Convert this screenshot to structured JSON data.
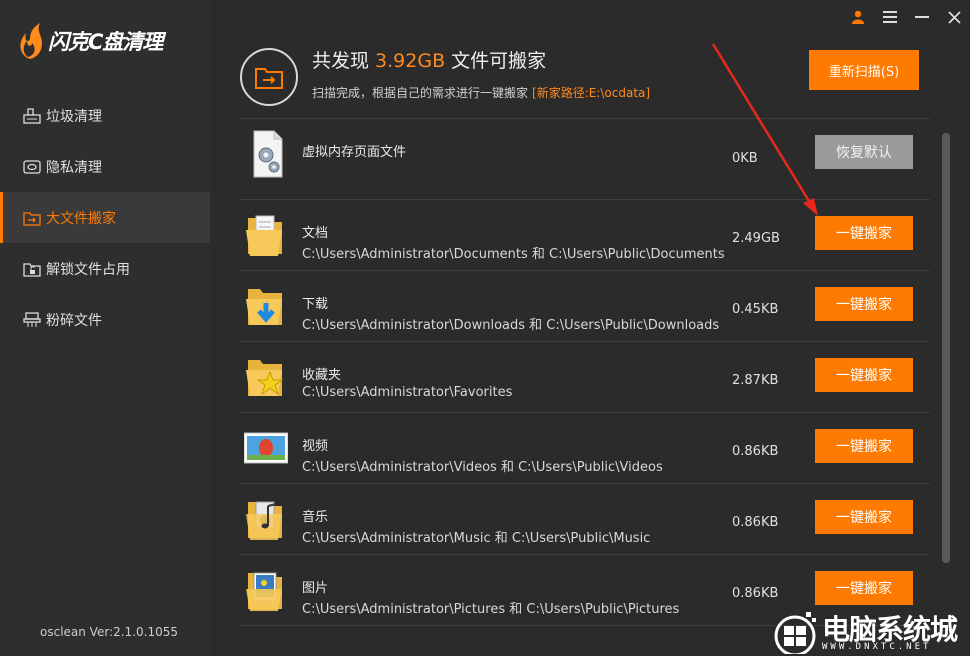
{
  "app": {
    "title": "闪克C盘清理",
    "version": "osclean Ver:2.1.0.1055"
  },
  "sidebar": {
    "items": [
      {
        "label": "垃圾清理",
        "icon": "broom-icon",
        "active": false
      },
      {
        "label": "隐私清理",
        "icon": "privacy-icon",
        "active": false
      },
      {
        "label": "大文件搬家",
        "icon": "move-file-icon",
        "active": true
      },
      {
        "label": "解锁文件占用",
        "icon": "unlock-file-icon",
        "active": false
      },
      {
        "label": "粉碎文件",
        "icon": "shredder-icon",
        "active": false
      }
    ]
  },
  "header": {
    "title_prefix": "共发现 ",
    "title_size": "3.92GB",
    "title_suffix": " 文件可搬家",
    "subtitle": "扫描完成，根据自己的需求进行一键搬家",
    "new_path": "[新家路径:E:\\ocdata]",
    "rescan_label": "重新扫描(S)"
  },
  "rows": [
    {
      "name": "虚拟内存页面文件",
      "path": "",
      "size": "0KB",
      "button": "恢复默认",
      "icon": "settings-file-icon"
    },
    {
      "name": "文档",
      "path": "C:\\Users\\Administrator\\Documents 和 C:\\Users\\Public\\Documents",
      "size": "2.49GB",
      "button": "一键搬家",
      "icon": "documents-folder-icon"
    },
    {
      "name": "下载",
      "path": "C:\\Users\\Administrator\\Downloads 和 C:\\Users\\Public\\Downloads",
      "size": "0.45KB",
      "button": "一键搬家",
      "icon": "downloads-folder-icon"
    },
    {
      "name": "收藏夹",
      "path": "C:\\Users\\Administrator\\Favorites",
      "size": "2.87KB",
      "button": "一键搬家",
      "icon": "favorites-folder-icon"
    },
    {
      "name": "视频",
      "path": "C:\\Users\\Administrator\\Videos 和 C:\\Users\\Public\\Videos",
      "size": "0.86KB",
      "button": "一键搬家",
      "icon": "videos-folder-icon"
    },
    {
      "name": "音乐",
      "path": "C:\\Users\\Administrator\\Music 和 C:\\Users\\Public\\Music",
      "size": "0.86KB",
      "button": "一键搬家",
      "icon": "music-folder-icon"
    },
    {
      "name": "图片",
      "path": "C:\\Users\\Administrator\\Pictures 和 C:\\Users\\Public\\Pictures",
      "size": "0.86KB",
      "button": "一键搬家",
      "icon": "pictures-folder-icon"
    }
  ],
  "watermark": {
    "text": "电脑系统城",
    "url": "WWW.DNXTC.NET"
  },
  "colors": {
    "accent": "#ff7a00",
    "background": "#2b2b2b",
    "sidebar": "#2e2e2e"
  }
}
